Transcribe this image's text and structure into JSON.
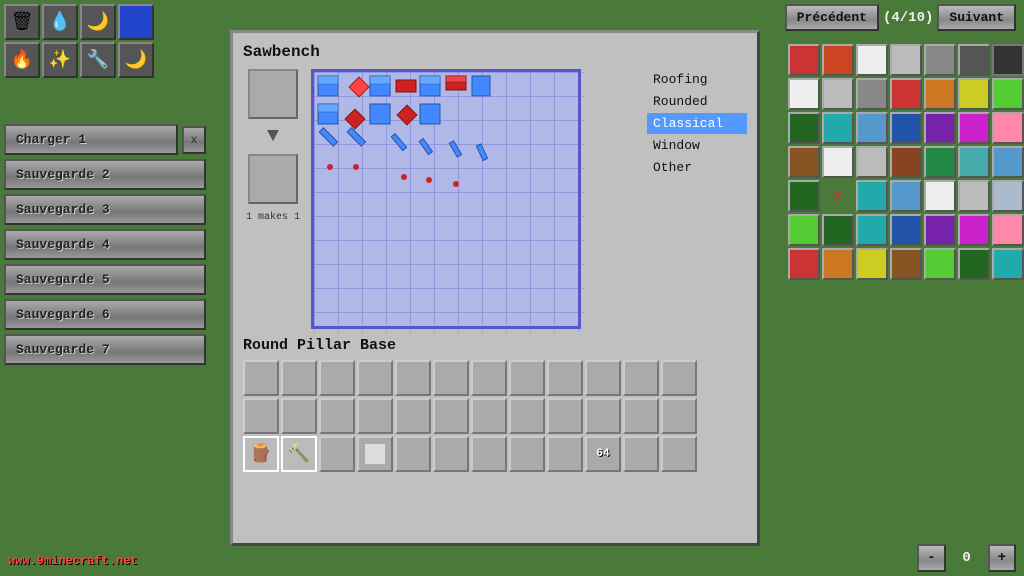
{
  "navigation": {
    "previous": "Précédent",
    "next": "Suivant",
    "count": "(4/10)"
  },
  "save_slots": [
    {
      "label": "Charger 1",
      "has_close": true
    },
    {
      "label": "Sauvegarde 2",
      "has_close": false
    },
    {
      "label": "Sauvegarde 3",
      "has_close": false
    },
    {
      "label": "Sauvegarde 4",
      "has_close": false
    },
    {
      "label": "Sauvegarde 5",
      "has_close": false
    },
    {
      "label": "Sauvegarde 6",
      "has_close": false
    },
    {
      "label": "Sauvegarde 7",
      "has_close": false
    }
  ],
  "dialog": {
    "title": "Sawbench",
    "item_name": "Round Pillar Base",
    "makes_label": "1 makes 1",
    "categories": [
      {
        "label": "Roofing",
        "active": false
      },
      {
        "label": "Rounded",
        "active": false
      },
      {
        "label": "Classical",
        "active": true
      },
      {
        "label": "Window",
        "active": false
      },
      {
        "label": "Other",
        "active": false
      }
    ]
  },
  "toolbar": {
    "item_count": "64",
    "close_label": "x"
  },
  "bottom_nav": {
    "minus": "-",
    "value": "0",
    "plus": "+"
  },
  "watermark": "www.9minecraft.net",
  "top_icons": [
    [
      "🗑",
      "💧",
      "🌙",
      "🔵"
    ],
    [
      "🔥",
      "✨",
      "🔧",
      "🌙"
    ]
  ]
}
